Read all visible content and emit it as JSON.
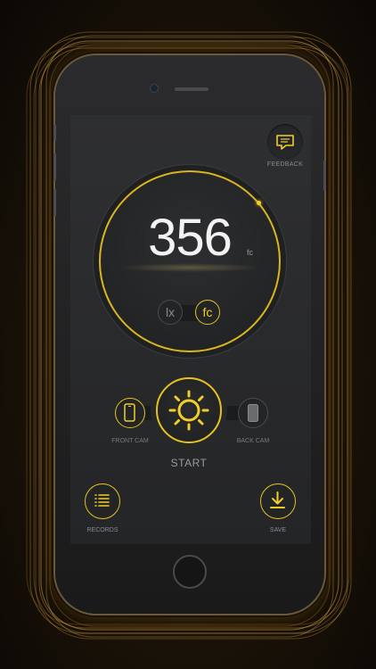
{
  "screen": {
    "feedback": {
      "label": "FEEDBACK",
      "icon": "speech-bubble-icon"
    },
    "reading": {
      "value": "356",
      "unit": "fc"
    },
    "unit_toggle": {
      "options": [
        "lx",
        "fc"
      ],
      "selected": "fc"
    },
    "controls": {
      "start_label": "START",
      "front_cam_label": "FRONT CAM",
      "back_cam_label": "BACK CAM",
      "active_camera": "front"
    },
    "bottom": {
      "records_label": "RECORDS",
      "save_label": "SAVE"
    }
  },
  "colors": {
    "accent": "#f3cd2a",
    "screen_bg": "#2a2b2d",
    "text_muted": "#8a8a8a",
    "reading_text": "#f3f3f3"
  }
}
